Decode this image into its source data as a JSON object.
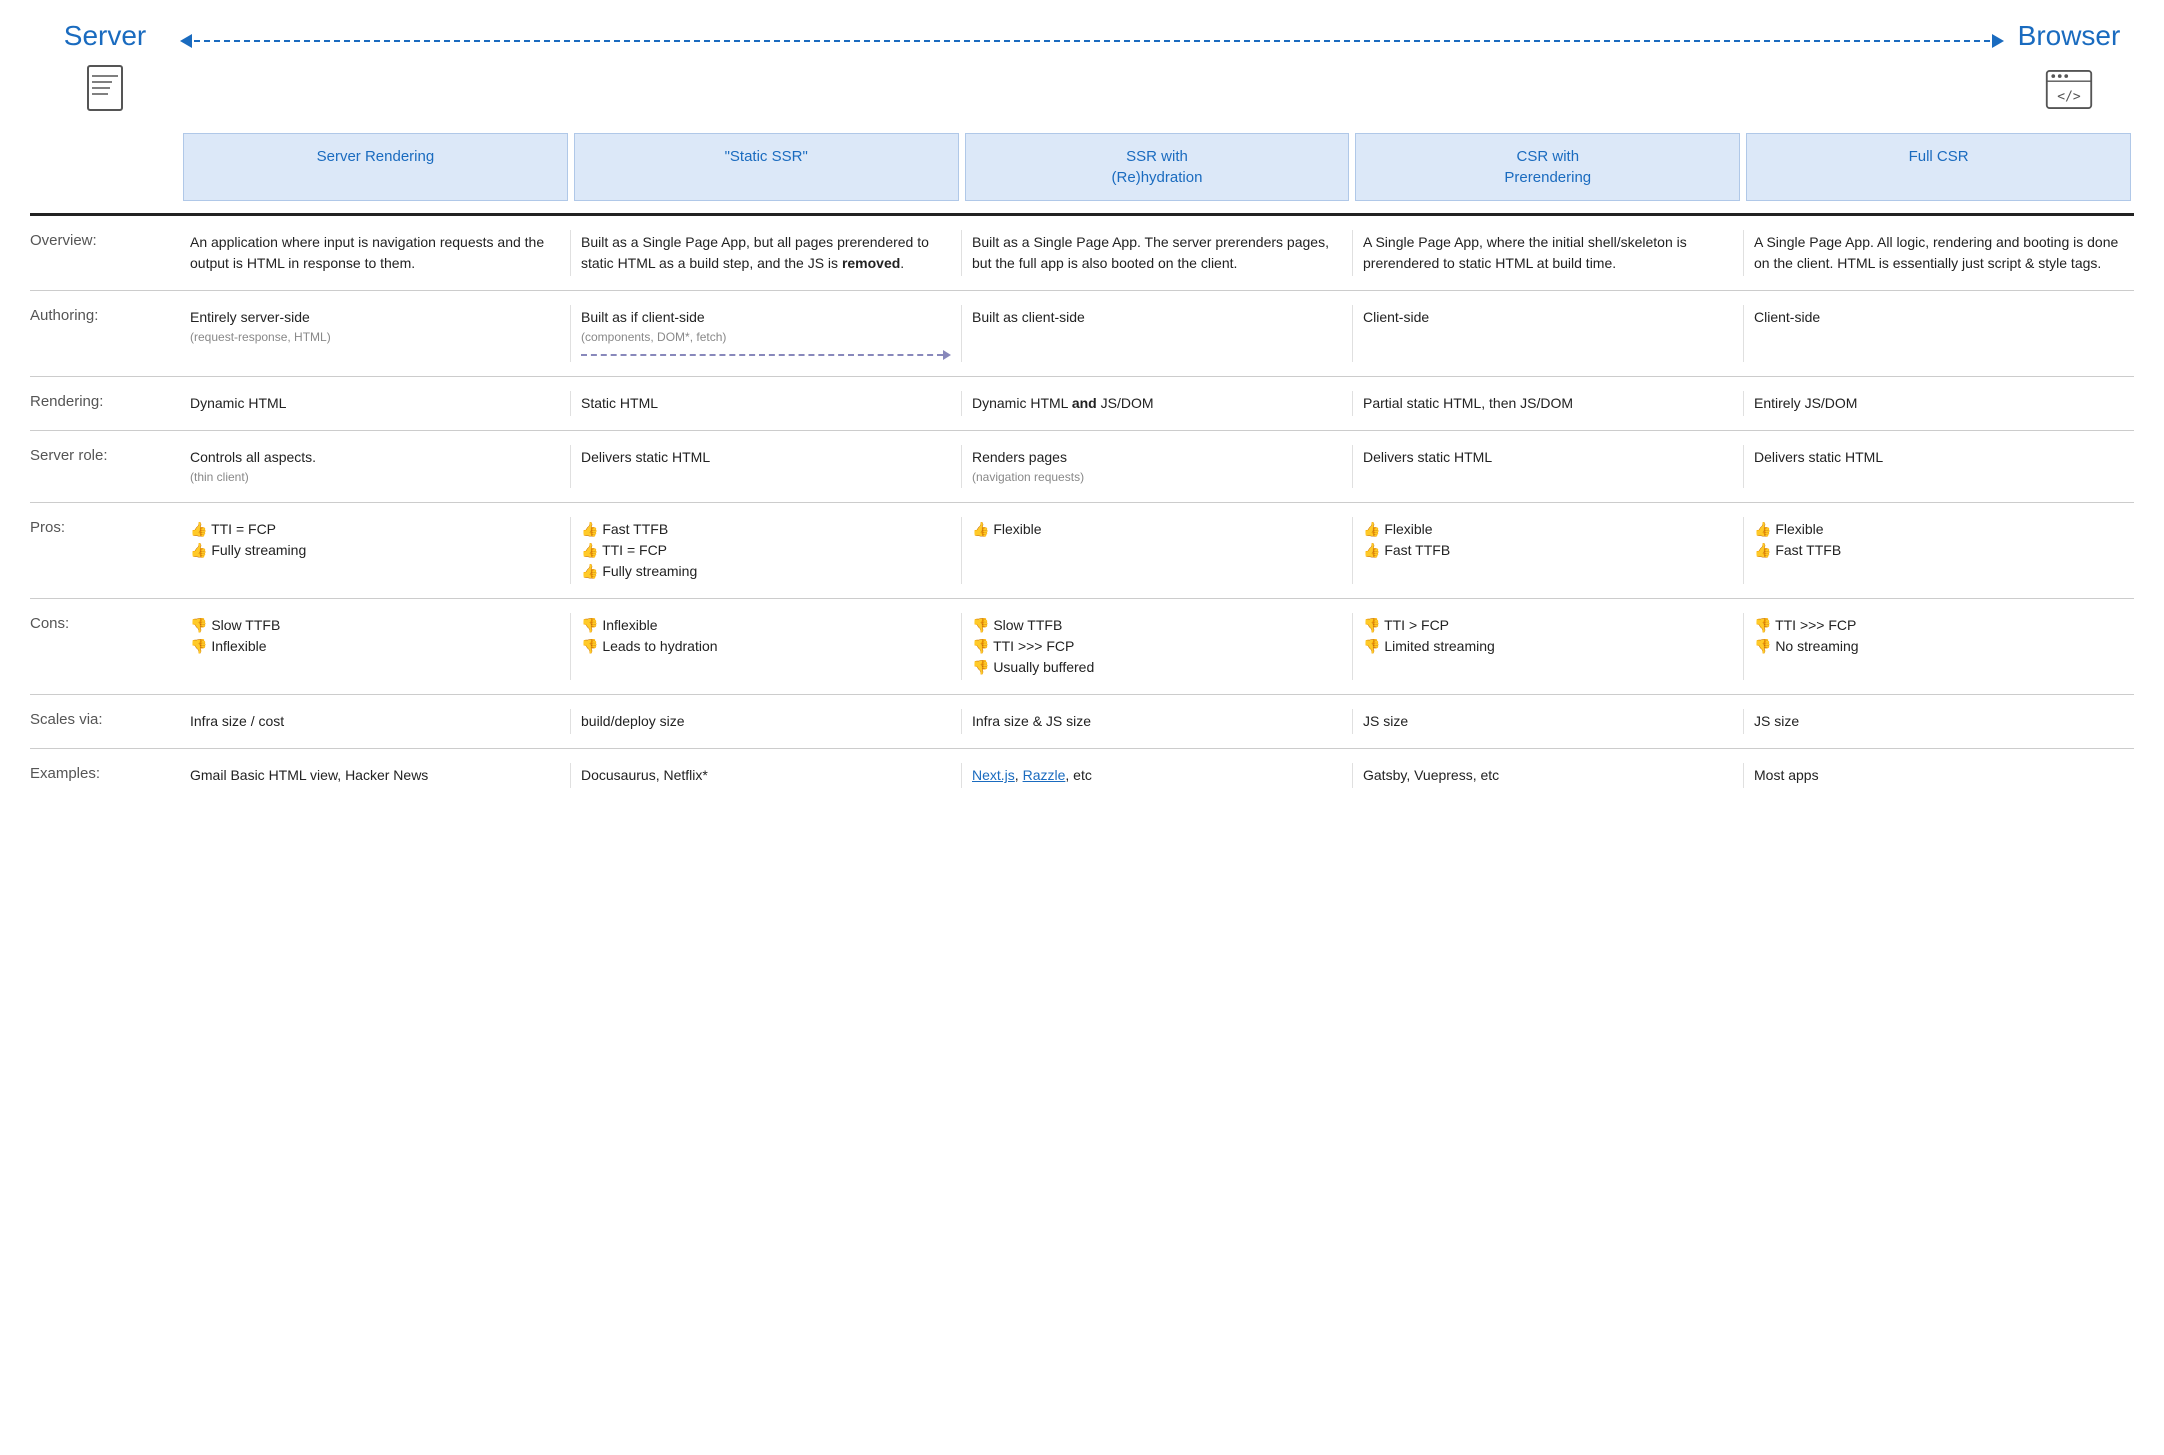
{
  "header": {
    "server_label": "Server",
    "browser_label": "Browser"
  },
  "columns": [
    {
      "label": "Server Rendering"
    },
    {
      "label": "\"Static SSR\""
    },
    {
      "label": "SSR with\n(Re)hydration"
    },
    {
      "label": "CSR with\nPrerendering"
    },
    {
      "label": "Full CSR"
    }
  ],
  "rows": [
    {
      "label": "Overview:",
      "cells": [
        "An application where input is navigation requests and the output is HTML in response to them.",
        "Built as a Single Page App, but all pages prerendered to static HTML as a build step, and the JS is removed.",
        "Built as a Single Page App. The server prerenders pages, but the full app is also booted on the client.",
        "A Single Page App, where the initial shell/skeleton is prerendered to static HTML at build time.",
        "A Single Page App. All logic, rendering and booting is done on the client. HTML is essentially just script & style tags."
      ]
    },
    {
      "label": "Authoring:",
      "cells": [
        {
          "main": "Entirely server-side",
          "sub": "(request-response, HTML)"
        },
        {
          "main": "Built as if client-side",
          "sub": "(components, DOM*, fetch)"
        },
        {
          "main": "Built as client-side",
          "sub": ""
        },
        {
          "main": "Client-side",
          "sub": ""
        },
        {
          "main": "Client-side",
          "sub": ""
        }
      ],
      "has_arrow": true
    },
    {
      "label": "Rendering:",
      "cells": [
        "Dynamic HTML",
        "Static HTML",
        "Dynamic HTML and JS/DOM",
        "Partial static HTML, then JS/DOM",
        "Entirely JS/DOM"
      ],
      "rendering_bold_index": 2
    },
    {
      "label": "Server role:",
      "cells": [
        {
          "main": "Controls all aspects.",
          "sub": "(thin client)"
        },
        {
          "main": "Delivers static HTML",
          "sub": ""
        },
        {
          "main": "Renders pages",
          "sub": "(navigation requests)"
        },
        {
          "main": "Delivers static HTML",
          "sub": ""
        },
        {
          "main": "Delivers static HTML",
          "sub": ""
        }
      ]
    },
    {
      "label": "Pros:",
      "cells": [
        [
          {
            "icon": "up",
            "text": "TTI = FCP"
          },
          {
            "icon": "up",
            "text": "Fully streaming"
          }
        ],
        [
          {
            "icon": "up",
            "text": "Fast TTFB"
          },
          {
            "icon": "up",
            "text": "TTI = FCP"
          },
          {
            "icon": "up",
            "text": "Fully streaming"
          }
        ],
        [
          {
            "icon": "up",
            "text": "Flexible"
          }
        ],
        [
          {
            "icon": "up",
            "text": "Flexible"
          },
          {
            "icon": "up",
            "text": "Fast TTFB"
          }
        ],
        [
          {
            "icon": "up",
            "text": "Flexible"
          },
          {
            "icon": "up",
            "text": "Fast TTFB"
          }
        ]
      ]
    },
    {
      "label": "Cons:",
      "cells": [
        [
          {
            "icon": "down",
            "text": "Slow TTFB"
          },
          {
            "icon": "down",
            "text": "Inflexible"
          }
        ],
        [
          {
            "icon": "down",
            "text": "Inflexible"
          },
          {
            "icon": "down",
            "text": "Leads to hydration"
          }
        ],
        [
          {
            "icon": "down",
            "text": "Slow TTFB"
          },
          {
            "icon": "down",
            "text": "TTI >>> FCP"
          },
          {
            "icon": "down",
            "text": "Usually buffered"
          }
        ],
        [
          {
            "icon": "down",
            "text": "TTI > FCP"
          },
          {
            "icon": "down",
            "text": "Limited streaming"
          }
        ],
        [
          {
            "icon": "down",
            "text": "TTI >>> FCP"
          },
          {
            "icon": "down",
            "text": "No streaming"
          }
        ]
      ]
    },
    {
      "label": "Scales via:",
      "cells": [
        "Infra size / cost",
        "build/deploy size",
        "Infra size & JS size",
        "JS size",
        "JS size"
      ]
    },
    {
      "label": "Examples:",
      "cells": [
        "Gmail Basic HTML view, Hacker News",
        "Docusaurus, Netflix*",
        {
          "links": [
            "Next.js",
            "Razzle"
          ],
          "suffix": ", etc"
        },
        "Gatsby, Vuepress, etc",
        "Most apps"
      ]
    }
  ]
}
